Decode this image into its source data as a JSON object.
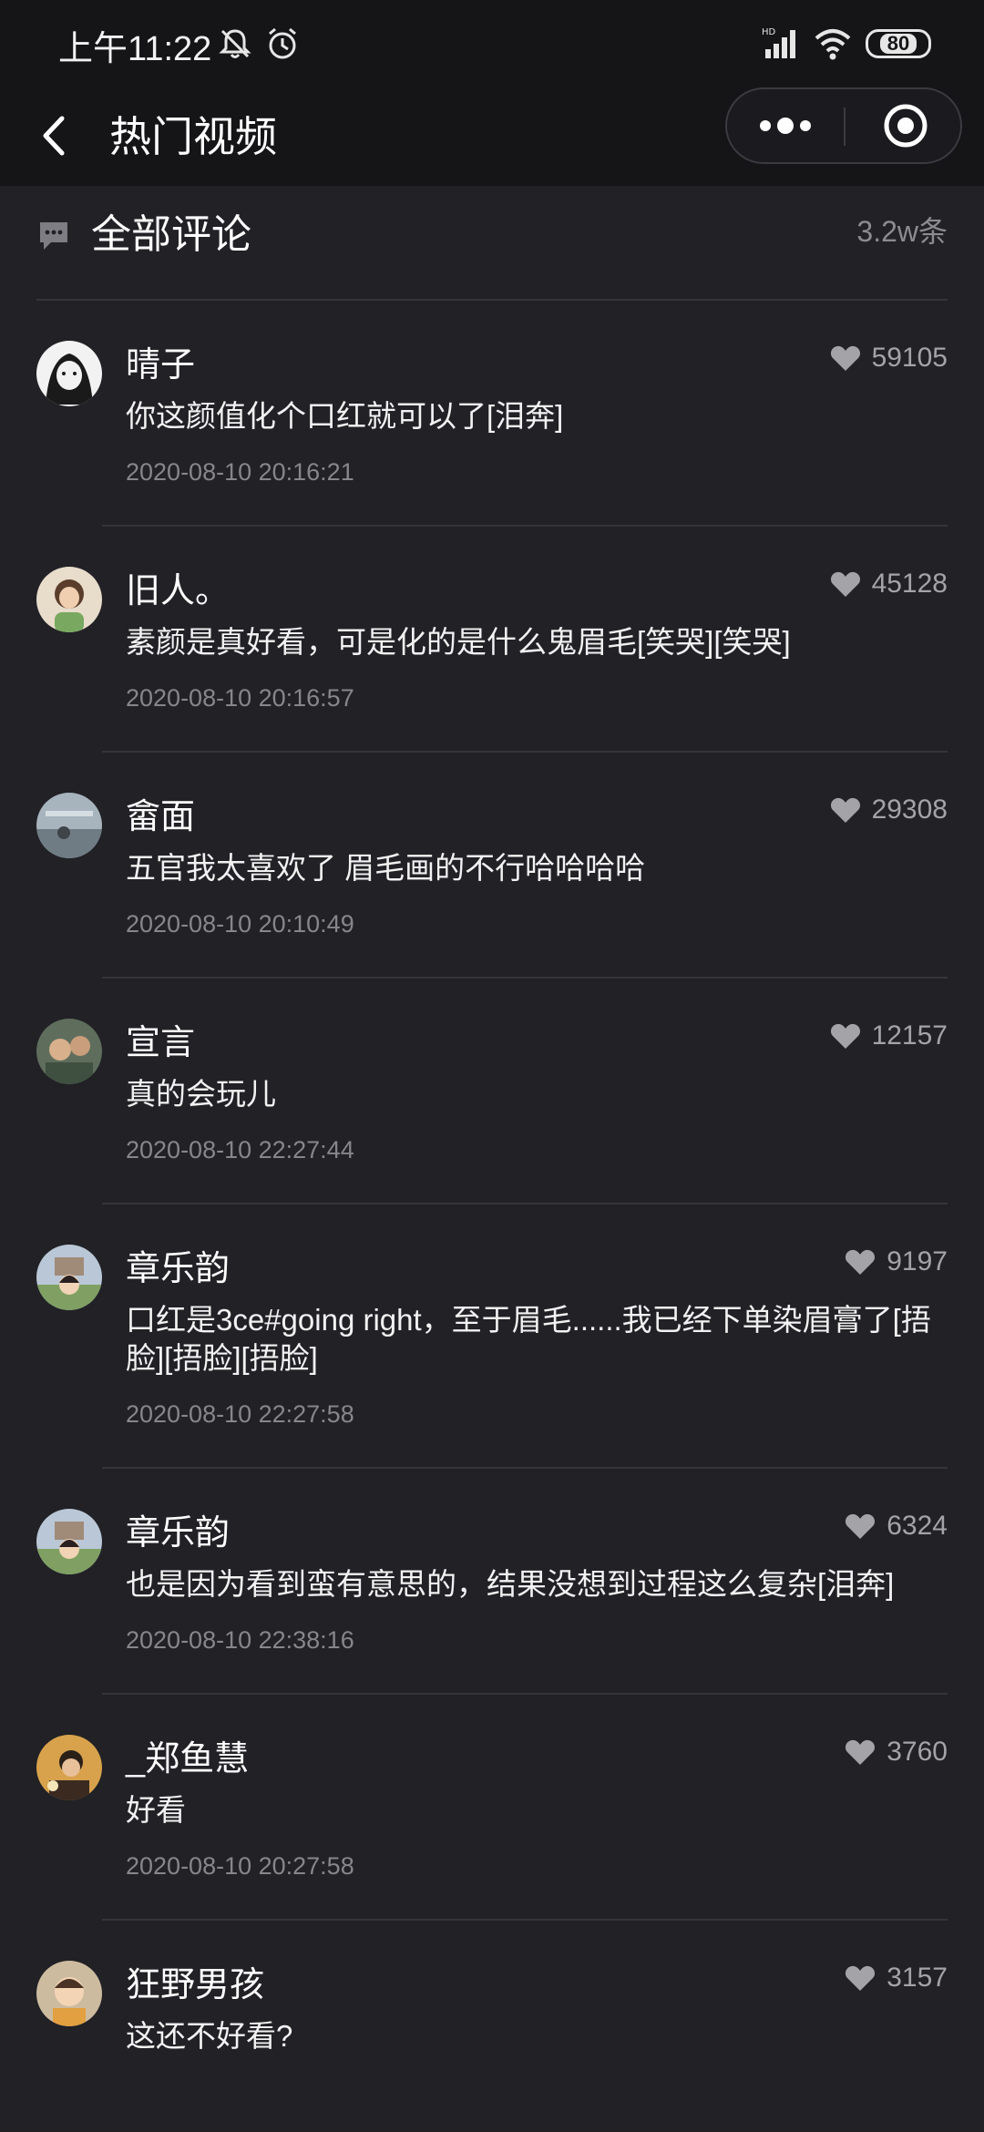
{
  "status_bar": {
    "time": "上午11:22",
    "battery": "80"
  },
  "nav": {
    "title": "热门视频"
  },
  "comments_header": {
    "title": "全部评论",
    "count": "3.2w条"
  },
  "comments": [
    {
      "user": "晴子",
      "likes": "59105",
      "text": "你这颜值化个口红就可以了[泪奔]",
      "time": "2020-08-10 20:16:21",
      "avatar_color": "#e9e9e9"
    },
    {
      "user": "旧人。",
      "likes": "45128",
      "text": "素颜是真好看，可是化的是什么鬼眉毛[笑哭][笑哭]",
      "time": "2020-08-10 20:16:57",
      "avatar_color": "#c9b49a"
    },
    {
      "user": "畲面",
      "likes": "29308",
      "text": "五官我太喜欢了 眉毛画的不行哈哈哈哈",
      "time": "2020-08-10 20:10:49",
      "avatar_color": "#8c97a0"
    },
    {
      "user": "宣言",
      "likes": "12157",
      "text": "真的会玩儿",
      "time": "2020-08-10 22:27:44",
      "avatar_color": "#6a7d6a"
    },
    {
      "user": "章乐韵",
      "likes": "9197",
      "text": "口红是3ce#going right，至于眉毛......我已经下单染眉膏了[捂脸][捂脸][捂脸]",
      "time": "2020-08-10 22:27:58",
      "avatar_color": "#9aa88c"
    },
    {
      "user": "章乐韵",
      "likes": "6324",
      "text": "也是因为看到蛮有意思的，结果没想到过程这么复杂[泪奔]",
      "time": "2020-08-10 22:38:16",
      "avatar_color": "#9aa88c"
    },
    {
      "user": "_郑鱼慧",
      "likes": "3760",
      "text": "好看",
      "time": "2020-08-10 20:27:58",
      "avatar_color": "#c89a52"
    },
    {
      "user": "狂野男孩",
      "likes": "3157",
      "text": "这还不好看?",
      "time": "",
      "avatar_color": "#b8a48a"
    }
  ]
}
